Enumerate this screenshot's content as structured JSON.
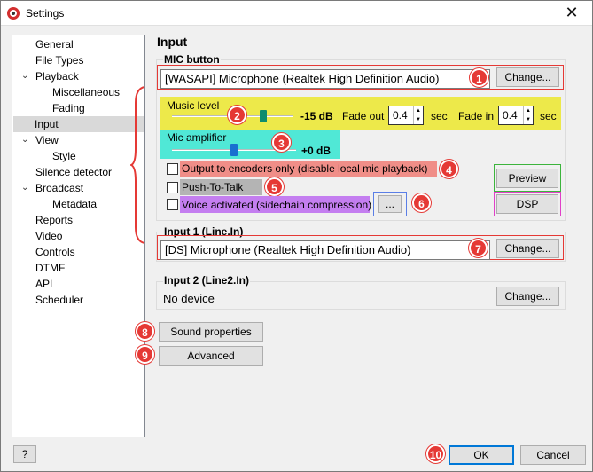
{
  "window": {
    "title": "Settings",
    "close_glyph": "✕"
  },
  "nav": {
    "items": [
      {
        "label": "General",
        "level": 0,
        "expander": ""
      },
      {
        "label": "File Types",
        "level": 0,
        "expander": ""
      },
      {
        "label": "Playback",
        "level": 0,
        "expander": "⌄"
      },
      {
        "label": "Miscellaneous",
        "level": 1,
        "expander": ""
      },
      {
        "label": "Fading",
        "level": 1,
        "expander": ""
      },
      {
        "label": "Input",
        "level": 0,
        "expander": "",
        "selected": true
      },
      {
        "label": "View",
        "level": 0,
        "expander": "⌄"
      },
      {
        "label": "Style",
        "level": 1,
        "expander": ""
      },
      {
        "label": "Silence detector",
        "level": 0,
        "expander": ""
      },
      {
        "label": "Broadcast",
        "level": 0,
        "expander": "⌄"
      },
      {
        "label": "Metadata",
        "level": 1,
        "expander": ""
      },
      {
        "label": "Reports",
        "level": 0,
        "expander": ""
      },
      {
        "label": "Video",
        "level": 0,
        "expander": ""
      },
      {
        "label": "Controls",
        "level": 0,
        "expander": ""
      },
      {
        "label": "DTMF",
        "level": 0,
        "expander": ""
      },
      {
        "label": "API",
        "level": 0,
        "expander": ""
      },
      {
        "label": "Scheduler",
        "level": 0,
        "expander": ""
      }
    ]
  },
  "page": {
    "title": "Input"
  },
  "mic": {
    "group_label": "MIC button",
    "device": "[WASAPI] Microphone (Realtek High Definition Audio)",
    "change_label": "Change...",
    "level_label": "Music level",
    "level_value": "-15 dB",
    "level_fraction": 0.76,
    "fade_out_label": "Fade out",
    "fade_out_value": "0.4",
    "fade_in_label": "Fade in",
    "fade_in_value": "0.4",
    "sec_label": "sec",
    "amp_label": "Mic amplifier",
    "amp_value": "+0 dB",
    "amp_fraction": 0.5,
    "output_encoders_label": "Output to encoders only (disable local mic playback)",
    "push_to_talk_label": "Push-To-Talk",
    "voice_activated_label": "Voice activated (sidechain compression)",
    "voice_settings_label": "...",
    "preview_label": "Preview",
    "dsp_label": "DSP"
  },
  "input1": {
    "group_label": "Input 1 (Line.In)",
    "device": "[DS] Microphone (Realtek High Definition Audio)",
    "change_label": "Change..."
  },
  "input2": {
    "group_label": "Input 2 (Line2.In)",
    "device": "No device",
    "change_label": "Change..."
  },
  "buttons": {
    "sound_properties": "Sound properties",
    "advanced": "Advanced",
    "help": "?",
    "ok": "OK",
    "cancel": "Cancel"
  },
  "badges": [
    "1",
    "2",
    "3",
    "4",
    "5",
    "6",
    "7",
    "8",
    "9",
    "10"
  ],
  "colors": {
    "red": "#e53935",
    "yellow": "#ede94a",
    "cyan": "#50e8d6",
    "salmon": "#f08e88",
    "gray": "#b4b4b4",
    "purple": "#c47ef0",
    "blue": "#5a7ee6",
    "green": "#3cb43c",
    "pink": "#e040c8",
    "thumb": "#0f8c6e",
    "thumb2": "#1a6fd0"
  }
}
